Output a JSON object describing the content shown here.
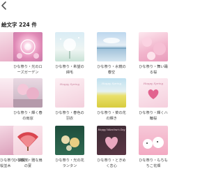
{
  "header": {
    "title": "絵文字 224 件"
  },
  "rows": [
    {
      "items": [
        {
          "caption": "",
          "left": true
        },
        {
          "caption": "ひな祭り・光のロ\nーズガーデン"
        },
        {
          "caption": "ひな祭り・希望の\n綿毛"
        },
        {
          "caption": "ひな祭り・水鏡の\n春空"
        },
        {
          "caption": "ひな祭り・舞い踊\nる桜"
        }
      ]
    },
    {
      "items": [
        {
          "caption": "",
          "left": true
        },
        {
          "caption": "ひな祭り・輝く春\nの雨窓"
        },
        {
          "caption": "ひな祭り・春色の\n羽衣"
        },
        {
          "caption": "ひな祭り・菜の花\nの輝き"
        },
        {
          "caption": "ひな祭り・輝くハ\n輪桜"
        }
      ]
    },
    {
      "items": [
        {
          "caption": "ひな祭り・満開の\n桜並木",
          "left": true
        },
        {
          "caption": "ひな祭り・雅な扇\nの宴"
        },
        {
          "caption": "ひな祭り・光の花\nランタン"
        },
        {
          "caption": "ひな祭り・ときめ\nく恋心"
        },
        {
          "caption": "ひな祭り・もちも\nちこ花畑"
        }
      ]
    }
  ],
  "thumb_text": {
    "t6": "Happy Spring",
    "t7": "Happy Spring",
    "t8": "Happy Spring",
    "t9": "Happy Spring",
    "t12": "Happy Valentine's Day"
  }
}
